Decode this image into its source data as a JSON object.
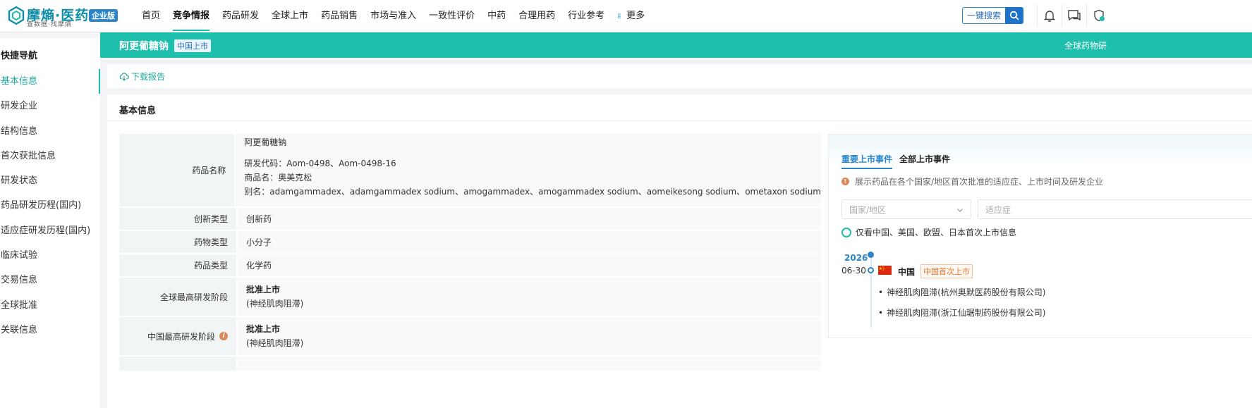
{
  "brand": {
    "name": "摩熵·医药",
    "tagline": "查数据·找摩熵",
    "badge": "企业版"
  },
  "nav": {
    "items": [
      "首页",
      "竞争情报",
      "药品研发",
      "全球上市",
      "药品销售",
      "市场与准入",
      "一致性评价",
      "中药",
      "合理用药",
      "行业参考"
    ],
    "active": "竞争情报",
    "more_label": "更多"
  },
  "search": {
    "label": "一键搜索"
  },
  "sidebar": {
    "title": "快捷导航",
    "items": [
      "基本信息",
      "研发企业",
      "结构信息",
      "首次获批信息",
      "研发状态",
      "药品研发历程(国内)",
      "适应症研发历程(国内)",
      "临床试验",
      "交易信息",
      "全球批准",
      "关联信息"
    ],
    "active": "基本信息"
  },
  "drug": {
    "name": "阿更葡糖钠",
    "tag": "中国上市",
    "right_text": "全球药物研"
  },
  "download": {
    "label": "下载报告"
  },
  "basic_info": {
    "title": "基本信息",
    "rows": {
      "name": {
        "label": "药品名称",
        "lines": [
          "阿更葡糖钠",
          "研发代码：Aom-0498、Aom-0498-16",
          "商品名：奥美克松",
          "别名：adamgammadex、adamgammadex sodium、amogammadex、amogammadex sodium、aomeikesong sodium、ometaxon sodium"
        ]
      },
      "innovation": {
        "label": "创新类型",
        "value": "创新药"
      },
      "molecule": {
        "label": "药物类型",
        "value": "小分子"
      },
      "drug_type": {
        "label": "药品类型",
        "value": "化学药"
      },
      "global_stage": {
        "label": "全球最高研发阶段",
        "value": "批准上市",
        "note": "(神经肌肉阻滞)"
      },
      "china_stage": {
        "label": "中国最高研发阶段",
        "value": "批准上市",
        "note": "(神经肌肉阻滞)"
      }
    }
  },
  "events": {
    "tabs": [
      "重要上市事件",
      "全部上市事件"
    ],
    "active_tab": "重要上市事件",
    "hint": "展示药品在各个国家/地区首次批准的适应症、上市时间及研发企业",
    "filters": {
      "country_placeholder": "国家/地区",
      "indication_placeholder": "适应症"
    },
    "checkbox_label": "仅看中国、美国、欧盟、日本首次上市信息",
    "timeline": {
      "year": "2026",
      "date": "06-30",
      "country": "中国",
      "badge": "中国首次上市",
      "items": [
        "神经肌肉阻滞(杭州奥默医药股份有限公司)",
        "神经肌肉阻滞(浙江仙琚制药股份有限公司)"
      ]
    }
  },
  "colors": {
    "accent": "#1fbfad",
    "link_blue": "#2a86c8",
    "brand": "#0f8ea7"
  }
}
